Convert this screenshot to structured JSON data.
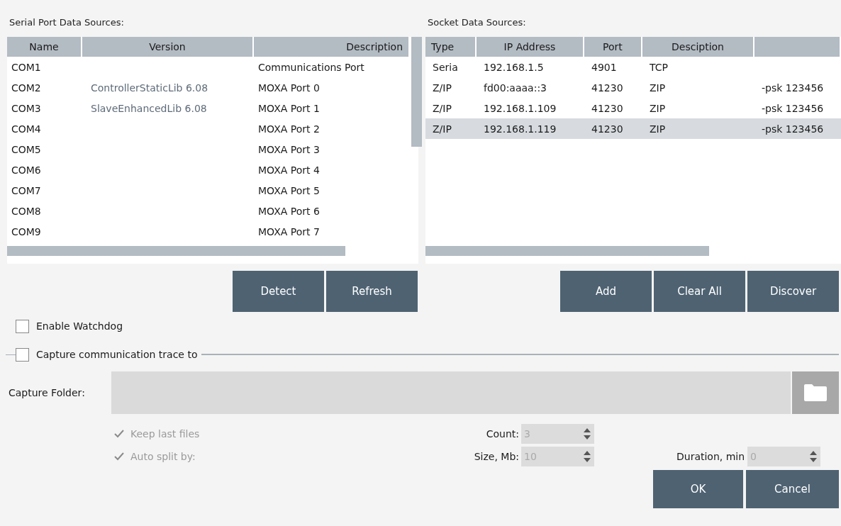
{
  "serial": {
    "title": "Serial Port Data Sources:",
    "columns": [
      "Name",
      "Version",
      "Description"
    ],
    "rows": [
      {
        "name": "COM1",
        "version": "",
        "description": "Communications Port"
      },
      {
        "name": "COM2",
        "version": "ControllerStaticLib 6.08",
        "description": "MOXA Port 0"
      },
      {
        "name": "COM3",
        "version": "SlaveEnhancedLib 6.08",
        "description": "MOXA Port 1"
      },
      {
        "name": "COM4",
        "version": "",
        "description": "MOXA Port 2"
      },
      {
        "name": "COM5",
        "version": "",
        "description": "MOXA Port 3"
      },
      {
        "name": "COM6",
        "version": "",
        "description": "MOXA Port 4"
      },
      {
        "name": "COM7",
        "version": "",
        "description": "MOXA Port 5"
      },
      {
        "name": "COM8",
        "version": "",
        "description": "MOXA Port 6"
      },
      {
        "name": "COM9",
        "version": "",
        "description": "MOXA Port 7"
      }
    ],
    "buttons": [
      "Detect",
      "Refresh"
    ]
  },
  "socket": {
    "title": "Socket Data Sources:",
    "columns": [
      "Type",
      "IP Address",
      "Port",
      "Desciption"
    ],
    "rows": [
      {
        "type": "Seria",
        "ip": "192.168.1.5",
        "port": "4901",
        "description": "TCP",
        "column_5": "",
        "selected": false
      },
      {
        "type": "Z/IP",
        "ip": "fd00:aaaa::3",
        "port": "41230",
        "description": "ZIP",
        "column_5": "-psk 123456",
        "selected": false
      },
      {
        "type": "Z/IP",
        "ip": "192.168.1.109",
        "port": "41230",
        "description": "ZIP",
        "column_5": "-psk 123456",
        "selected": false
      },
      {
        "type": "Z/IP",
        "ip": "192.168.1.119",
        "port": "41230",
        "description": "ZIP",
        "column_5": "-psk 123456",
        "selected": true
      }
    ],
    "buttons": [
      "Add",
      "Clear All",
      "Discover"
    ]
  },
  "enable_watchdog": {
    "label": "Enable Watchdog",
    "checked": false
  },
  "capture_trace": {
    "label": "Capture communication trace to",
    "checked": false
  },
  "capture_folder": {
    "label": "Capture Folder:"
  },
  "keep_last_files": {
    "label": "Keep last files",
    "checked": true,
    "disabled": true
  },
  "auto_split": {
    "label": "Auto split by:",
    "checked": true,
    "disabled": true
  },
  "count": {
    "label": "Count:",
    "value": "3"
  },
  "size": {
    "label": "Size, Mb:",
    "value": "10"
  },
  "duration": {
    "label": "Duration, min",
    "value": "0"
  },
  "buttons": [
    "OK",
    "Cancel"
  ]
}
